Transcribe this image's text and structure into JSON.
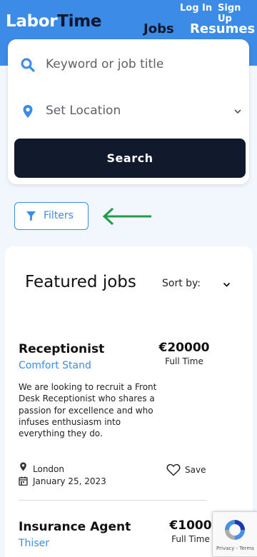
{
  "header": {
    "logo_part1": "Labor",
    "logo_part2": "Time",
    "login": "Log In",
    "signup": "Sign Up",
    "nav_jobs": "Jobs",
    "nav_resumes": "Resumes"
  },
  "search": {
    "keyword_placeholder": "Keyword or job title",
    "location_placeholder": "Set Location",
    "button_label": "Search"
  },
  "filters": {
    "label": "Filters"
  },
  "featured": {
    "title": "Featured jobs",
    "sort_label": "Sort by:"
  },
  "jobs": [
    {
      "title": "Receptionist",
      "company": "Comfort Stand",
      "salary": "€20000",
      "type": "Full Time",
      "description": "We are looking to recruit a Front Desk Receptionist who shares a passion for excellence and who infuses enthusiasm into everything they do.",
      "location": "London",
      "date": "January 25, 2023",
      "save_label": "Save"
    },
    {
      "title": "Insurance Agent",
      "company": "Thiser",
      "salary": "€1000",
      "type": "Full Time"
    }
  ],
  "recaptcha": {
    "text": "Privacy - Terms"
  },
  "colors": {
    "primary": "#3c8be6",
    "dark": "#111a2c",
    "background": "#f2f6fd",
    "arrow": "#1f9d4a"
  },
  "icons": {
    "keyword": "search-icon",
    "location": "map-pin-icon",
    "location_dropdown": "chevron-down-icon",
    "filters": "filter-funnel-icon",
    "annotation": "arrow-left-icon",
    "sort": "chevron-down-icon",
    "job_location": "map-marker-icon",
    "job_date": "calendar-icon",
    "save": "heart-icon",
    "recaptcha": "recaptcha-icon"
  }
}
